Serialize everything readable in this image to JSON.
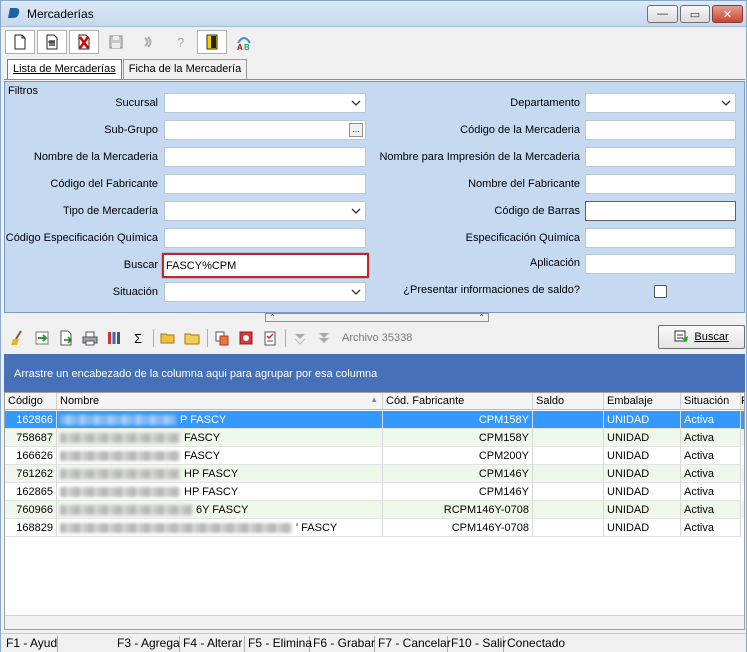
{
  "window": {
    "title": "Mercaderías",
    "controls": {
      "minimize": "—",
      "maximize": "▭",
      "close": "✕"
    }
  },
  "toolbar": {
    "buttons": [
      {
        "name": "new-document-icon"
      },
      {
        "name": "edit-document-icon"
      },
      {
        "name": "delete-document-icon"
      },
      {
        "name": "save-disk-icon"
      },
      {
        "name": "refresh-arrows-icon"
      },
      {
        "name": "help-question-icon"
      },
      {
        "name": "exit-door-icon"
      },
      {
        "name": "spell-check-icon"
      }
    ]
  },
  "tabs": [
    {
      "label": "Lista de Mercaderías",
      "active": true
    },
    {
      "label": "Ficha de la Mercadería",
      "active": false
    }
  ],
  "filters": {
    "title": "Filtros",
    "left": [
      {
        "label": "Sucursal",
        "value": "",
        "type": "dropdown"
      },
      {
        "label": "Sub-Grupo",
        "value": "",
        "type": "lookup",
        "button": "..."
      },
      {
        "label": "Nombre de la Mercaderia",
        "value": "",
        "type": "text"
      },
      {
        "label": "Código del Fabricante",
        "value": "",
        "type": "text"
      },
      {
        "label": "Tipo de Mercadería",
        "value": "",
        "type": "dropdown"
      },
      {
        "label": "Código Especificación Química",
        "value": "",
        "type": "text"
      },
      {
        "label": "Buscar",
        "value": "FASCY%CPM",
        "type": "text"
      },
      {
        "label": "Situación",
        "value": "",
        "type": "dropdown"
      }
    ],
    "right": [
      {
        "label": "Departamento",
        "value": "",
        "type": "dropdown"
      },
      {
        "label": "Código de la Mercaderia",
        "value": "",
        "type": "text"
      },
      {
        "label": "Nombre para Impresión de la Mercaderia",
        "value": "",
        "type": "text"
      },
      {
        "label": "Nombre del Fabricante",
        "value": "",
        "type": "text"
      },
      {
        "label": "Código de Barras",
        "value": "",
        "type": "text"
      },
      {
        "label": "Especificación Química",
        "value": "",
        "type": "text"
      },
      {
        "label": "Aplicación",
        "value": "",
        "type": "text"
      },
      {
        "label": "¿Presentar informaciones de saldo?",
        "checked": false,
        "type": "checkbox"
      }
    ]
  },
  "splitter": {
    "left": "⌃",
    "right": "⌃"
  },
  "grid_toolbar": {
    "icons": [
      "broom-icon",
      "export-green-icon",
      "export-page-icon",
      "print-icon",
      "columns-icon",
      "sum-sigma-icon",
      "open-folder-icon",
      "folder-icon",
      "copy-icon",
      "record-icon",
      "checklist-icon",
      "collapse-icon",
      "expand-icon"
    ],
    "sigma": "Σ",
    "archivo": "Archivo 35338",
    "buscar_label": "Buscar"
  },
  "grid": {
    "group_hint": "Arrastre un encabezado de la columna aqui para agrupar por esa columna",
    "columns": [
      "Código",
      "Nombre",
      "Cód. Fabricante",
      "Saldo",
      "Embalaje",
      "Situación",
      "F"
    ],
    "rows": [
      {
        "codigo": "162866",
        "nombre": "P FASCY",
        "fabricante": "CPM158Y",
        "saldo": "",
        "embalaje": "UNIDAD",
        "situacion": "Activa"
      },
      {
        "codigo": "758687",
        "nombre": "FASCY",
        "fabricante": "CPM158Y",
        "saldo": "",
        "embalaje": "UNIDAD",
        "situacion": "Activa"
      },
      {
        "codigo": "166626",
        "nombre": "FASCY",
        "fabricante": "CPM200Y",
        "saldo": "",
        "embalaje": "UNIDAD",
        "situacion": "Activa"
      },
      {
        "codigo": "761262",
        "nombre": "HP FASCY",
        "fabricante": "CPM146Y",
        "saldo": "",
        "embalaje": "UNIDAD",
        "situacion": "Activa"
      },
      {
        "codigo": "162865",
        "nombre": "HP FASCY",
        "fabricante": "CPM146Y",
        "saldo": "",
        "embalaje": "UNIDAD",
        "situacion": "Activa"
      },
      {
        "codigo": "760966",
        "nombre": "6Y FASCY",
        "fabricante": "RCPM146Y-0708",
        "saldo": "",
        "embalaje": "UNIDAD",
        "situacion": "Activa"
      },
      {
        "codigo": "168829",
        "nombre": "' FASCY",
        "fabricante": "CPM146Y-0708",
        "saldo": "",
        "embalaje": "UNIDAD",
        "situacion": "Activa"
      }
    ]
  },
  "statusbar": [
    "F1 - Ayud",
    "F3 - Agrega",
    "F4 - Alterar",
    "F5 - Elimina",
    "F6 - Grabar",
    "F7 - Cancelar",
    "F10 - Salir",
    "Conectado"
  ],
  "colors": {
    "filters_bg": "#c5d9f1",
    "group_band": "#4670b8",
    "selected_row": "#3399ff",
    "alt_row": "#eef8ea",
    "highlight_border": "#c0262d"
  }
}
